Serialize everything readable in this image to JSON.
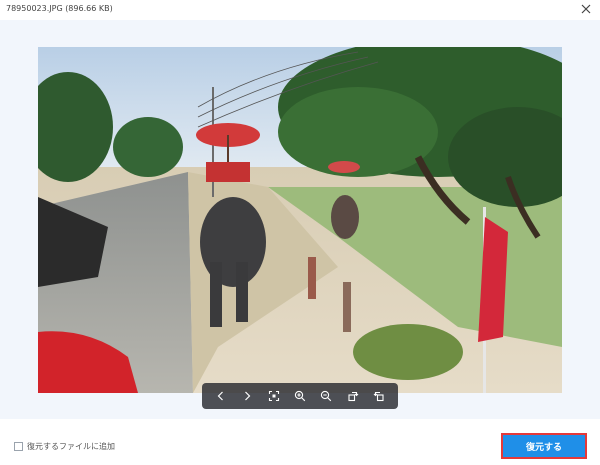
{
  "window": {
    "title": "78950023.JPG (896.66 KB)",
    "close_icon": "close-icon"
  },
  "viewer": {
    "toolbar": [
      {
        "name": "previous-icon",
        "glyph": "‹"
      },
      {
        "name": "next-icon",
        "glyph": "›"
      },
      {
        "name": "fit-to-window-icon",
        "glyph": "⤢"
      },
      {
        "name": "zoom-in-icon",
        "glyph": "+"
      },
      {
        "name": "zoom-out-icon",
        "glyph": "−"
      },
      {
        "name": "rotate-left-icon",
        "glyph": "↺"
      },
      {
        "name": "rotate-right-icon",
        "glyph": "↻"
      }
    ]
  },
  "footer": {
    "add_to_restore_label": "復元するファイルに追加",
    "add_to_restore_checked": false,
    "restore_button": "復元する"
  },
  "colors": {
    "accent": "#1f8fe8",
    "highlight_border": "#e53939",
    "preview_bg": "#f2f6fc",
    "toolbar_bg": "#2a2c30"
  }
}
